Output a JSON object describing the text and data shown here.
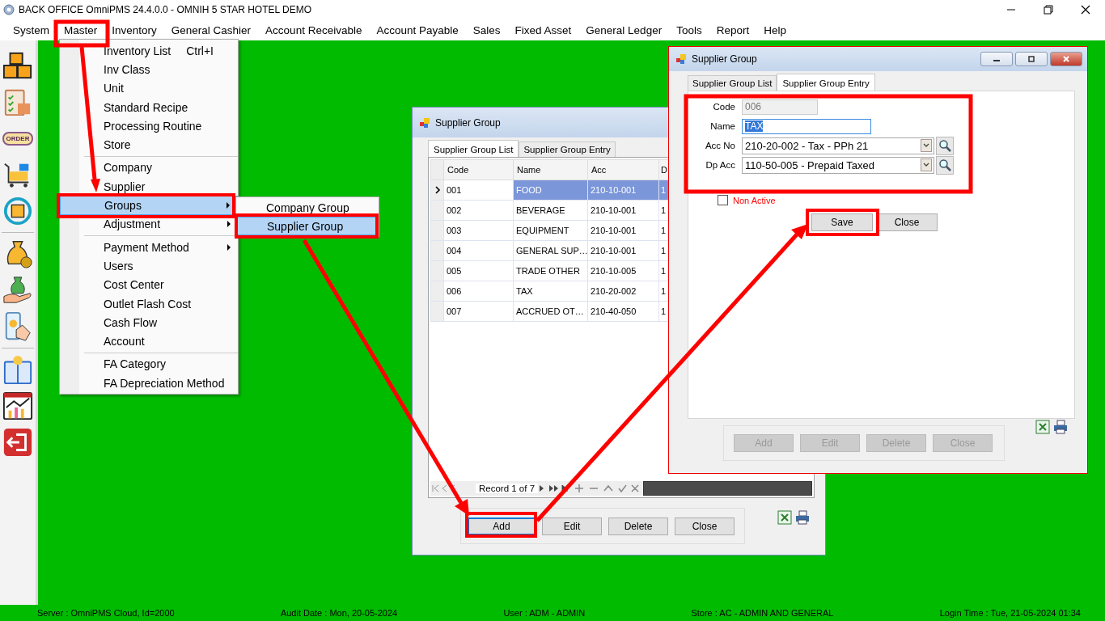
{
  "window": {
    "title": "BACK OFFICE OmniPMS 24.4.0.0 - OMNIH 5 STAR HOTEL DEMO"
  },
  "menu_bar": [
    "System",
    "Master",
    "Inventory",
    "General Cashier",
    "Account Receivable",
    "Account Payable",
    "Sales",
    "Fixed Asset",
    "General Ledger",
    "Tools",
    "Report",
    "Help"
  ],
  "toolbar": {
    "order_label": "ORDER"
  },
  "master_menu": [
    {
      "kind": "item",
      "label": "Inventory List",
      "shortcut": "Ctrl+I",
      "submenu": false,
      "selected": false
    },
    {
      "kind": "item",
      "label": "Inv Class",
      "submenu": false,
      "selected": false
    },
    {
      "kind": "item",
      "label": "Unit",
      "submenu": false,
      "selected": false
    },
    {
      "kind": "item",
      "label": "Standard Recipe",
      "submenu": false,
      "selected": false
    },
    {
      "kind": "item",
      "label": "Processing Routine",
      "submenu": false,
      "selected": false
    },
    {
      "kind": "item",
      "label": "Store",
      "submenu": false,
      "selected": false
    },
    {
      "kind": "separator"
    },
    {
      "kind": "item",
      "label": "Company",
      "submenu": false,
      "selected": false
    },
    {
      "kind": "item",
      "label": "Supplier",
      "submenu": false,
      "selected": false
    },
    {
      "kind": "item",
      "label": "Groups",
      "submenu": true,
      "selected": true
    },
    {
      "kind": "item",
      "label": "Adjustment",
      "submenu": true,
      "selected": false
    },
    {
      "kind": "separator"
    },
    {
      "kind": "item",
      "label": "Payment Method",
      "submenu": true,
      "selected": false
    },
    {
      "kind": "item",
      "label": "Users",
      "submenu": false,
      "selected": false
    },
    {
      "kind": "item",
      "label": "Cost Center",
      "submenu": false,
      "selected": false
    },
    {
      "kind": "item",
      "label": "Outlet Flash Cost",
      "submenu": false,
      "selected": false
    },
    {
      "kind": "item",
      "label": "Cash Flow",
      "submenu": false,
      "selected": false
    },
    {
      "kind": "item",
      "label": "Account",
      "submenu": false,
      "selected": false
    },
    {
      "kind": "separator"
    },
    {
      "kind": "item",
      "label": "FA Category",
      "submenu": false,
      "selected": false
    },
    {
      "kind": "item",
      "label": "FA Depreciation Method",
      "submenu": false,
      "selected": false
    }
  ],
  "groups_submenu": [
    {
      "label": "Company Group",
      "selected": false
    },
    {
      "label": "Supplier Group",
      "selected": true
    }
  ],
  "list_window": {
    "title": "Supplier Group",
    "tabs": [
      {
        "label": "Supplier Group List",
        "selected": true
      },
      {
        "label": "Supplier Group Entry",
        "selected": false
      }
    ],
    "columns": [
      "Code",
      "Name",
      "Acc",
      "D"
    ],
    "rows": [
      {
        "cells": [
          "001",
          "FOOD",
          "210-10-001",
          "1"
        ],
        "selected": true
      },
      {
        "cells": [
          "002",
          "BEVERAGE",
          "210-10-001",
          "1"
        ],
        "selected": false
      },
      {
        "cells": [
          "003",
          "EQUIPMENT",
          "210-10-001",
          "1"
        ],
        "selected": false
      },
      {
        "cells": [
          "004",
          "GENERAL SUP…",
          "210-10-001",
          "1"
        ],
        "selected": false
      },
      {
        "cells": [
          "005",
          "TRADE OTHER",
          "210-10-005",
          "1"
        ],
        "selected": false
      },
      {
        "cells": [
          "006",
          "TAX",
          "210-20-002",
          "1"
        ],
        "selected": false
      },
      {
        "cells": [
          "007",
          "ACCRUED OT…",
          "210-40-050",
          "1"
        ],
        "selected": false
      }
    ],
    "navigator": "Record 1 of 7",
    "buttons": [
      {
        "label": "Add",
        "focused": true
      },
      {
        "label": "Edit",
        "focused": false
      },
      {
        "label": "Delete",
        "focused": false
      },
      {
        "label": "Close",
        "focused": false
      }
    ]
  },
  "entry_window": {
    "title": "Supplier Group",
    "tabs": [
      {
        "label": "Supplier Group List",
        "selected": false
      },
      {
        "label": "Supplier Group Entry",
        "selected": true
      }
    ],
    "fields": [
      {
        "label": "Code",
        "value": "006",
        "kind": "readonly"
      },
      {
        "label": "Name",
        "value": "TAX",
        "kind": "text",
        "text_selected": true
      },
      {
        "label": "Acc No",
        "value": "210-20-002 - Tax - PPh 21",
        "kind": "combo"
      },
      {
        "label": "Dp Acc",
        "value": "110-50-005 - Prepaid Taxed",
        "kind": "combo"
      }
    ],
    "non_active": {
      "label": "Non Active",
      "checked": false
    },
    "form_buttons": [
      "Save",
      "Close"
    ],
    "bottom_buttons": [
      {
        "label": "Add",
        "disabled": true
      },
      {
        "label": "Edit",
        "disabled": true
      },
      {
        "label": "Delete",
        "disabled": true
      },
      {
        "label": "Close",
        "disabled": true
      }
    ]
  },
  "status_bar": [
    "Server : OmniPMS Cloud, Id=2000",
    "Audit Date : Mon, 20-05-2024",
    "User : ADM - ADMIN",
    "Store : AC - ADMIN AND GENERAL",
    "Login Time : Tue, 21-05-2024 01:34"
  ]
}
